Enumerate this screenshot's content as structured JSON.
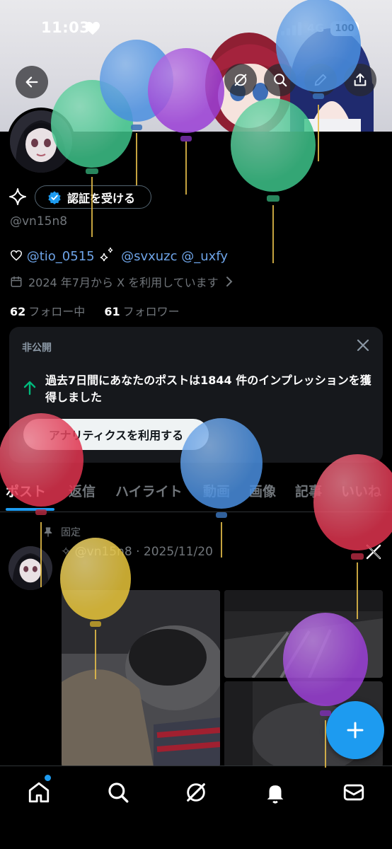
{
  "status_bar": {
    "time": "11:03",
    "network": "4G",
    "battery": "100"
  },
  "header": {
    "back_icon": "arrow-left-icon",
    "actions": [
      "grok-icon",
      "search-icon",
      "pencil-icon",
      "share-icon"
    ]
  },
  "profile": {
    "verify_label": "認証を受ける",
    "handle": "@vn15n8",
    "bio_mention_1": "@tio_0515",
    "bio_mention_2": "@svxuzc",
    "bio_mention_3": "@_uxfy",
    "joined": "2024 年7月から X を利用しています",
    "following_count": "62",
    "following_label": "フォロー中",
    "followers_count": "61",
    "followers_label": "フォロワー"
  },
  "insight_card": {
    "title": "非公開",
    "text": "過去7日間にあなたのポストは1844 件のインプレッションを獲得しました",
    "button": "アナリティクスを利用する"
  },
  "tabs": [
    {
      "label": "ポスト"
    },
    {
      "label": "返信"
    },
    {
      "label": "ハイライト"
    },
    {
      "label": "動画"
    },
    {
      "label": "画像"
    },
    {
      "label": "記事"
    },
    {
      "label": "いいね"
    }
  ],
  "pinned_post": {
    "pinned_label": "固定",
    "meta": "✧ @vn15n8 · 2025/11/20"
  },
  "bottom_nav": [
    "home-icon",
    "search-icon",
    "grok-icon",
    "notifications-icon",
    "messages-icon"
  ],
  "colors": {
    "accent": "#1d9bf0",
    "link": "#6ea4e8",
    "muted": "#71767b"
  }
}
